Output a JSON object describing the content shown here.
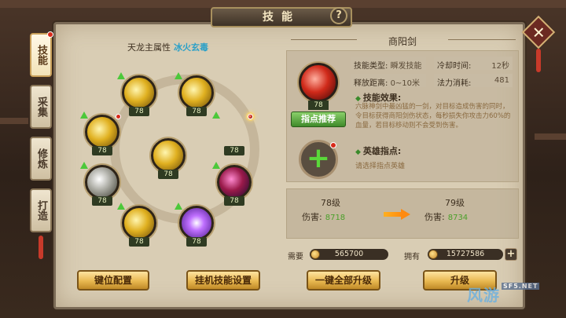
{
  "window": {
    "title": "技能",
    "help": "?",
    "close": "✕"
  },
  "tabs": [
    {
      "label": "技能",
      "active": true,
      "badge": true
    },
    {
      "label": "采集",
      "active": false,
      "badge": false
    },
    {
      "label": "修炼",
      "active": false,
      "badge": false
    },
    {
      "label": "打造",
      "active": false,
      "badge": false
    }
  ],
  "left": {
    "attr_label": "天龙主属性",
    "attr_value": "冰火玄毒"
  },
  "skills": [
    {
      "level": "78",
      "color": "gold",
      "upgrade": true,
      "badge": false
    },
    {
      "level": "78",
      "color": "gold",
      "upgrade": true,
      "badge": false
    },
    {
      "level": "78",
      "color": "gold",
      "upgrade": true,
      "badge": true
    },
    {
      "level": "78",
      "color": "red",
      "upgrade": true,
      "badge": false,
      "selected": true
    },
    {
      "level": "78",
      "color": "gold",
      "upgrade": false,
      "badge": false
    },
    {
      "level": "78",
      "color": "silver",
      "upgrade": true,
      "badge": false
    },
    {
      "level": "78",
      "color": "redpurple",
      "upgrade": true,
      "badge": false
    },
    {
      "level": "78",
      "color": "gold",
      "upgrade": true,
      "badge": false
    },
    {
      "level": "78",
      "color": "purple",
      "upgrade": true,
      "badge": false
    }
  ],
  "detail": {
    "name": "商阳剑",
    "level": "78",
    "recommend_label": "指点推荐",
    "stats": {
      "type_label": "技能类型:",
      "type_value": "瞬发技能",
      "cooldown_label": "冷却时间:",
      "cooldown_value": "12秒",
      "range_label": "释放距离:",
      "range_value": "0~10米",
      "mana_label": "法力消耗:",
      "mana_value": "481"
    },
    "effect_head": "技能效果:",
    "effect_text": "六脉神剑中最凶猛的一剑，对目标造成伤害的同时，令目标获得商阳剑伤状态，每秒损失你攻击力60%的血量，若目标移动则不会受到伤害。",
    "hero_head": "英雄指点:",
    "hero_hint": "请选择指点英雄"
  },
  "compare": {
    "current_level": "78级",
    "next_level": "79级",
    "damage_label": "伤害:",
    "current_damage": "8718",
    "next_damage": "8734"
  },
  "cost": {
    "need_label": "需要",
    "need_value": "565700",
    "have_label": "拥有",
    "have_value": "15727586",
    "plus": "+"
  },
  "buttons": {
    "keybind": "键位配置",
    "auto_skill": "挂机技能设置",
    "upgrade_all": "一键全部升级",
    "upgrade": "升级"
  },
  "watermark": {
    "text": "风游",
    "site": "SF5.NET"
  }
}
